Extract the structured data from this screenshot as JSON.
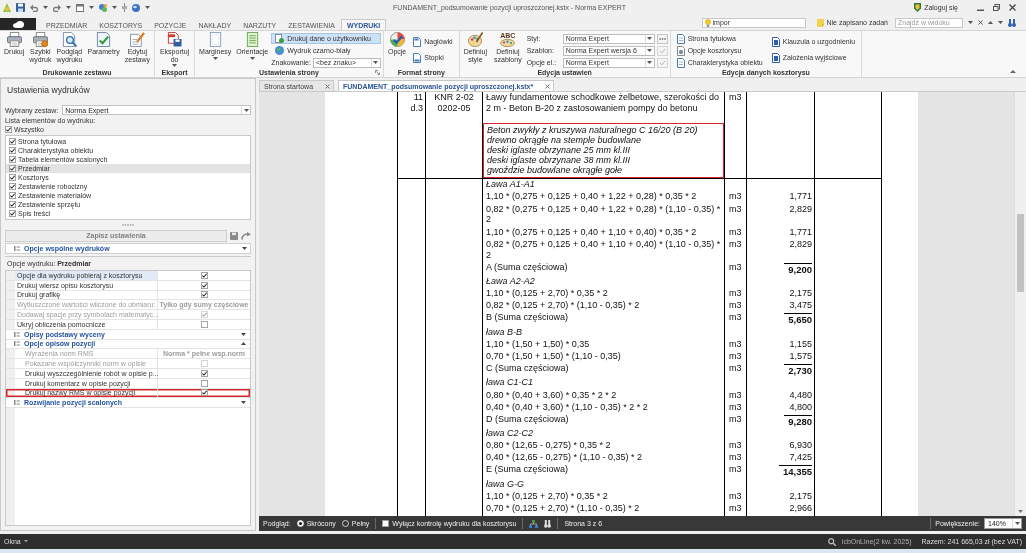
{
  "title_bar": {
    "title": "FUNDAMENT_podsumowanie pozycji uproszczonej.kstx - Norma EXPERT",
    "login": "Zaloguj się"
  },
  "ribbon_tabs": [
    {
      "label": "PRZEDMIAR",
      "selected": false
    },
    {
      "label": "KOSZTORYS",
      "selected": false
    },
    {
      "label": "POZYCJE",
      "selected": false
    },
    {
      "label": "NAKŁADY",
      "selected": false
    },
    {
      "label": "NARZUTY",
      "selected": false
    },
    {
      "label": "ZESTAWIENIA",
      "selected": false
    },
    {
      "label": "WYDRUKI",
      "selected": true
    }
  ],
  "quick_search": {
    "value": "impor"
  },
  "tasks": {
    "label": "Nie zapisano zadań"
  },
  "find": {
    "placeholder": "Znajdź w widoku"
  },
  "ribbon_groups": [
    {
      "title": "Drukowanie zestawu",
      "columns": [
        {
          "kind": "large",
          "label": "Drukuj"
        },
        {
          "kind": "large",
          "label": "Szybki wydruk"
        },
        {
          "kind": "large",
          "label": "Podgląd wydruku"
        },
        {
          "kind": "large",
          "label": "Parametry"
        },
        {
          "kind": "large",
          "label": "Edytuj zestawy"
        }
      ]
    },
    {
      "title": "Eksport",
      "columns": [
        {
          "kind": "large",
          "label": "Eksportuj do",
          "dropdown": true
        }
      ]
    },
    {
      "title": "Ustawienia strony",
      "launcher": true,
      "columns": [
        {
          "kind": "large",
          "label": "Marginesy",
          "dropdown": true
        },
        {
          "kind": "large",
          "label": "Orientacje",
          "dropdown": true
        },
        {
          "kind": "stack",
          "items": [
            {
              "kind": "small",
              "label": "Drukuj dane o użytkowniku",
              "on": true
            },
            {
              "kind": "small",
              "label": "Wydruk czarno-biały",
              "on": false
            },
            {
              "kind": "combo",
              "label": "Znakowanie:",
              "value": "<bez znaku>"
            }
          ]
        }
      ]
    },
    {
      "title": "Format strony",
      "columns": [
        {
          "kind": "large",
          "label": "Opcje"
        },
        {
          "kind": "stack",
          "items": [
            {
              "kind": "small",
              "label": "Nagłówki"
            },
            {
              "kind": "small",
              "label": "Stopki"
            }
          ]
        }
      ]
    },
    {
      "title": "Edycja ustawień",
      "columns": [
        {
          "kind": "large",
          "label": "Definiuj style"
        },
        {
          "kind": "large",
          "label": "Definiuj szablony",
          "lettering": "ABC"
        },
        {
          "kind": "stack",
          "items": [
            {
              "kind": "combo",
              "label": "Styl:",
              "value": "Norma Expert",
              "more_button": true
            },
            {
              "kind": "combo",
              "label": "Szablon:",
              "value": "Norma Expert wersja 6",
              "apply_button": true
            },
            {
              "kind": "combo",
              "label": "Opcje el.:",
              "value": "Norma Expert",
              "apply_button": true
            }
          ]
        }
      ]
    },
    {
      "title": "Edycja danych kosztorysu",
      "columns": [
        {
          "kind": "stack",
          "items": [
            {
              "kind": "small",
              "label": "Strona tytułowa"
            },
            {
              "kind": "small",
              "label": "Opcje kosztorysu"
            },
            {
              "kind": "small",
              "label": "Charakterystyka obiektu"
            }
          ]
        },
        {
          "kind": "stack",
          "items": [
            {
              "kind": "small",
              "label": "Klauzula o uzgodnieniu"
            },
            {
              "kind": "small",
              "label": "Założenia wyjściowe"
            }
          ]
        }
      ]
    }
  ],
  "print_settings": {
    "title": "Ustawienia wydruków",
    "set_label": "Wybrany zestaw:",
    "set_value": "Norma Expert",
    "list_label": "Lista elementów do wydruku:",
    "all": {
      "label": "Wszystko",
      "checked": true
    },
    "elements": [
      {
        "label": "Strona tytułowa",
        "checked": true,
        "selected": false
      },
      {
        "label": "Charakterystyka obiektu",
        "checked": true,
        "selected": false
      },
      {
        "label": "Tabela elementów scalonych",
        "checked": true,
        "selected": false
      },
      {
        "label": "Przedmiar",
        "checked": true,
        "selected": true
      },
      {
        "label": "Kosztorys",
        "checked": true,
        "selected": false
      },
      {
        "label": "Zestawienie robocizny",
        "checked": true,
        "selected": false
      },
      {
        "label": "Zestawienie materiałów",
        "checked": true,
        "selected": false
      },
      {
        "label": "Zestawienie sprzętu",
        "checked": true,
        "selected": false
      },
      {
        "label": "Spis treści",
        "checked": true,
        "selected": false
      }
    ],
    "save_button": {
      "label": "Zapisz ustawienia",
      "disabled": true
    },
    "common_section": {
      "title": "Opcje wspólne wydruków",
      "expanded": false
    },
    "options_caption": "Opcje wydruku: **Przedmiar**",
    "options": [
      {
        "kind": "check",
        "label": "Opcje dla wydruku pobieraj z kosztorysu",
        "checked": true,
        "disabled": false,
        "selected": true
      },
      {
        "kind": "check",
        "label": "Drukuj wiersz opisu kosztorysu",
        "checked": true,
        "disabled": false,
        "selected": false
      },
      {
        "kind": "check",
        "label": "Drukuj grafikę",
        "checked": true,
        "disabled": false,
        "selected": false
      },
      {
        "kind": "text",
        "label": "Wytłuszczone wartości wliczone do obmiaru:",
        "value": "Tylko gdy sumy częściowe",
        "disabled": true,
        "selected": false
      },
      {
        "kind": "check",
        "label": "Dodawaj spacje przy symbolach matematyc...",
        "checked": true,
        "disabled": true,
        "selected": false
      },
      {
        "kind": "check",
        "label": "Ukryj obliczenia pomocnicze",
        "checked": false,
        "disabled": false,
        "selected": false
      },
      {
        "kind": "section",
        "title": "Opisy podstawy wyceny",
        "expanded": false
      },
      {
        "kind": "section",
        "title": "Opcje opisów pozycji",
        "expanded": true,
        "children": [
          {
            "kind": "text",
            "label": "Wyrażenia norm RMS",
            "value": "Norma * pełne wsp.norm",
            "disabled": true,
            "highlighted": false
          },
          {
            "kind": "check",
            "label": "Pokazane współczynniki norm w opisie",
            "checked": false,
            "disabled": true,
            "highlighted": false
          },
          {
            "kind": "check",
            "label": "Drukuj wyszczególnienie robót w opisie p...",
            "checked": true,
            "disabled": false,
            "highlighted": false
          },
          {
            "kind": "check",
            "label": "Drukuj komentarz w opisie pozycji",
            "checked": false,
            "disabled": false,
            "highlighted": false
          },
          {
            "kind": "check",
            "label": "Drukuj nazwy RMS w opisie pozycji",
            "checked": true,
            "disabled": false,
            "highlighted": true
          }
        ]
      },
      {
        "kind": "section",
        "title": "Rozwijanie pozycji scalonych",
        "expanded": false
      }
    ]
  },
  "document_tabs": [
    {
      "label": "Strona startowa",
      "selected": false
    },
    {
      "label": "FUNDAMENT_podsumowanie pozycji uproszczonej.kstx*",
      "selected": true
    }
  ],
  "document": {
    "position": {
      "number": "11",
      "suffix": "d.3",
      "basis": "KNR 2-02 0202-05",
      "description": "Ławy fundamentowe schodkowe żelbetowe, szerokości do 2 m - Beton B-20 z zastosowaniem pompy do betonu",
      "unit": "m3"
    },
    "resources": {
      "highlighted": true,
      "lines": [
        "Beton zwykły z kruszywa naturalnego C 16/20 (B 20)",
        "drewno okrągłe na stemple budowlane",
        "deski iglaste obrzynane 25 mm kl.III",
        "deski iglaste obrzynane 38 mm kl.III",
        "gwoździe budowlane okrągłe gołe"
      ]
    },
    "measurements": [
      {
        "kind": "heading",
        "text": "Ława A1-A1"
      },
      {
        "kind": "line",
        "text": "1,10 * (0,275 + 0,125 + 0,40 + 1,22 + 0,28) * 0,35 * 2",
        "unit": "m3",
        "value": "1,771"
      },
      {
        "kind": "line",
        "text": "0,82 * (0,275 + 0,125 + 0,40 + 1,22 + 0,28) * (1,10 - 0,35) * 2",
        "unit": "m3",
        "value": "2,829"
      },
      {
        "kind": "line",
        "text": "1,10 * (0,275 + 0,125 + 0,40 + 1,10 + 0,40) * 0,35 * 2",
        "unit": "m3",
        "value": "1,771"
      },
      {
        "kind": "line",
        "text": "0,82 * (0,275 + 0,125 + 0,40 + 1,10 + 0,40) * (1,10 - 0,35) * 2",
        "unit": "m3",
        "value": "2,829"
      },
      {
        "kind": "sum",
        "text": "A (Suma częściowa)",
        "unit": "m3",
        "value": "9,200"
      },
      {
        "kind": "heading",
        "text": "Ława A2-A2"
      },
      {
        "kind": "line",
        "text": "1,10 * (0,125 + 2,70) * 0,35 * 2",
        "unit": "m3",
        "value": "2,175"
      },
      {
        "kind": "line",
        "text": "0,82 * (0,125 + 2,70) * (1,10 - 0,35) * 2",
        "unit": "m3",
        "value": "3,475"
      },
      {
        "kind": "sum",
        "text": "B (Suma częściowa)",
        "unit": "m3",
        "value": "5,650"
      },
      {
        "kind": "heading",
        "text": "ława B-B"
      },
      {
        "kind": "line",
        "text": "1,10 * (1,50 + 1,50) * 0,35",
        "unit": "m3",
        "value": "1,155"
      },
      {
        "kind": "line",
        "text": "0,70 * (1,50 + 1,50) * (1,10 - 0,35)",
        "unit": "m3",
        "value": "1,575"
      },
      {
        "kind": "sum",
        "text": "C (Suma częściowa)",
        "unit": "m3",
        "value": "2,730"
      },
      {
        "kind": "heading",
        "text": "ława C1-C1"
      },
      {
        "kind": "line",
        "text": "0,80 * (0,40 + 3,60) * 0,35 * 2 * 2",
        "unit": "m3",
        "value": "4,480"
      },
      {
        "kind": "line",
        "text": "0,40 * (0,40 + 3,60) * (1,10 - 0,35) * 2 * 2",
        "unit": "m3",
        "value": "4,800"
      },
      {
        "kind": "sum",
        "text": "D (Suma częściowa)",
        "unit": "m3",
        "value": "9,280"
      },
      {
        "kind": "heading",
        "text": "ława C2-C2"
      },
      {
        "kind": "line",
        "text": "0,80 * (12,65 - 0,275) * 0,35 * 2",
        "unit": "m3",
        "value": "6,930"
      },
      {
        "kind": "line",
        "text": "0,40 * (12,65 - 0,275) * (1,10 - 0,35) * 2",
        "unit": "m3",
        "value": "7,425"
      },
      {
        "kind": "sum",
        "text": "E (Suma częściowa)",
        "unit": "m3",
        "value": "14,355"
      },
      {
        "kind": "heading",
        "text": "ława G-G"
      },
      {
        "kind": "line",
        "text": "1,10 * (0,125 + 2,70) * 0,35 * 2",
        "unit": "m3",
        "value": "2,175"
      },
      {
        "kind": "line",
        "text": "0,70 * (0,125 + 2,70) * (1,10 - 0,35) * 2",
        "unit": "m3",
        "value": "2,966"
      }
    ]
  },
  "preview_bar": {
    "label": "Podgląd:",
    "modes": [
      {
        "label": "Skrócony",
        "selected": true
      },
      {
        "label": "Pełny",
        "selected": false
      }
    ],
    "control_check": {
      "label": "Wyłącz kontrolę wydruku dla kosztorysu",
      "checked": false
    },
    "page": "Strona 3 z 6",
    "zoom_label": "Powiększenie:",
    "zoom": "140%"
  },
  "status_bar": {
    "menu": "Okna",
    "service": "icbOnLine(2 kw. 2025)",
    "total": "Razem: 241 665,03 zł (bez VAT)"
  }
}
